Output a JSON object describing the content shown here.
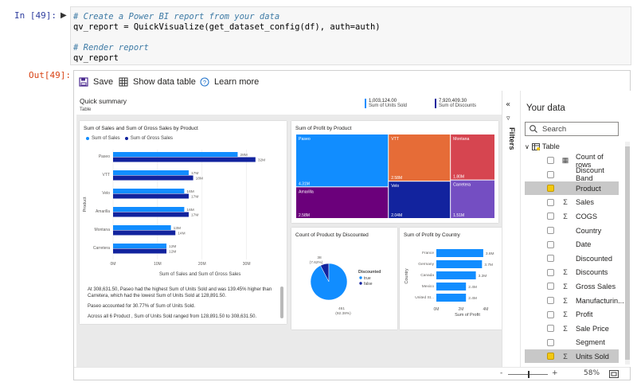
{
  "cell_in": {
    "prompt": "In [49]:",
    "lines": [
      "# Create a Power BI report from your data",
      "qv_report = QuickVisualize(get_dataset_config(df), auth=auth)",
      "",
      "# Render report",
      "qv_report"
    ]
  },
  "cell_out": {
    "prompt": "Out[49]:"
  },
  "toolbar": {
    "save": "Save",
    "show_data": "Show data table",
    "learn": "Learn more"
  },
  "summary": {
    "title": "Quick summary",
    "subtitle": "Table",
    "kpis": [
      {
        "value": "1,003,124.00",
        "label": "Sum of Units Sold"
      },
      {
        "value": "7,920,409.30",
        "label": "Sum of Discounts"
      }
    ]
  },
  "chart_data": [
    {
      "type": "bar",
      "title": "Sum of Sales and Sum of Gross Sales by Product",
      "xlabel": "Sum of Sales and Sum of Gross Sales",
      "ylabel": "Product",
      "categories": [
        "Paseo",
        "VTT",
        "Velo",
        "Amarilla",
        "Montana",
        "Carretera"
      ],
      "series": [
        {
          "name": "Sum of Sales",
          "values": [
            28,
            17,
            16,
            16,
            13,
            12
          ],
          "labels": [
            "28M",
            "17M",
            "16M",
            "16M",
            "13M",
            "12M"
          ],
          "color": "#118dff"
        },
        {
          "name": "Sum of Gross Sales",
          "values": [
            32,
            18,
            17,
            17,
            14,
            12
          ],
          "labels": [
            "32M",
            "18M",
            "17M",
            "17M",
            "14M",
            "12M"
          ],
          "color": "#12239e"
        }
      ],
      "xticks": [
        "0M",
        "10M",
        "20M",
        "30M"
      ],
      "xlim": [
        0,
        34
      ]
    },
    {
      "type": "heatmap",
      "title": "Sum of Profit by Product",
      "items": [
        {
          "name": "Paseo",
          "value": 4.31,
          "label": "4.31M",
          "color": "#118dff"
        },
        {
          "name": "VTT",
          "value": 2.58,
          "label": "2.58M",
          "color": "#e66c37"
        },
        {
          "name": "Montana",
          "value": 1.8,
          "label": "1.80M",
          "color": "#d64550"
        },
        {
          "name": "Amarilla",
          "value": 2.58,
          "label": "2.58M",
          "color": "#6b007b"
        },
        {
          "name": "Velo",
          "value": 2.04,
          "label": "2.04M",
          "color": "#12239e"
        },
        {
          "name": "Carretera",
          "value": 1.51,
          "label": "1.51M",
          "color": "#744ec2"
        }
      ]
    },
    {
      "type": "pie",
      "title": "Count of Product by Discounted",
      "legend_title": "Discounted",
      "slices": [
        {
          "name": "true",
          "value": 461,
          "pct": "(92.38%)",
          "color": "#118dff"
        },
        {
          "name": "false",
          "value": 38,
          "pct": "(7.62%)",
          "color": "#12239e"
        }
      ]
    },
    {
      "type": "bar",
      "title": "Sum of Profit by Country",
      "xlabel": "Sum of Profit",
      "ylabel": "Country",
      "categories": [
        "France",
        "Germany",
        "Canada",
        "Mexico",
        "United St..."
      ],
      "values": [
        3.8,
        3.7,
        3.2,
        2.4,
        2.4
      ],
      "labels": [
        "3.8M",
        "3.7M",
        "3.2M",
        "2.4M",
        "2.4M"
      ],
      "xticks": [
        "0M",
        "2M",
        "4M"
      ],
      "xlim": [
        0,
        4
      ]
    }
  ],
  "narrative": [
    "At 308,631.50,  Paseo had the highest Sum of Units Sold and was 139.45% higher than  Carretera, which had the lowest Sum of Units Sold at 128,891.50.",
    "Paseo accounted for 30.77% of Sum of Units Sold.",
    "Across all 6  Product , Sum of Units Sold ranged from 128,891.50 to 308,631.50."
  ],
  "filters_label": "Filters",
  "your_data": {
    "title": "Your data",
    "search_placeholder": "Search",
    "table_name": "Table",
    "fields": [
      {
        "name": "Count of rows",
        "icon": "calc",
        "checked": false
      },
      {
        "name": "Discount Band",
        "icon": "",
        "checked": false
      },
      {
        "name": "Product",
        "icon": "",
        "checked": true
      },
      {
        "name": "Sales",
        "icon": "sigma",
        "checked": false
      },
      {
        "name": "COGS",
        "icon": "sigma",
        "checked": false
      },
      {
        "name": "Country",
        "icon": "",
        "checked": false
      },
      {
        "name": "Date",
        "icon": "",
        "checked": false
      },
      {
        "name": "Discounted",
        "icon": "",
        "checked": false
      },
      {
        "name": "Discounts",
        "icon": "sigma",
        "checked": false
      },
      {
        "name": "Gross Sales",
        "icon": "sigma",
        "checked": false
      },
      {
        "name": "Manufacturin...",
        "icon": "sigma",
        "checked": false
      },
      {
        "name": "Profit",
        "icon": "sigma",
        "checked": false
      },
      {
        "name": "Sale Price",
        "icon": "sigma",
        "checked": false
      },
      {
        "name": "Segment",
        "icon": "",
        "checked": false
      },
      {
        "name": "Units Sold",
        "icon": "sigma",
        "checked": true
      }
    ]
  },
  "zoom": {
    "minus": "-",
    "plus": "+",
    "value": "58%",
    "level": 0.58
  }
}
